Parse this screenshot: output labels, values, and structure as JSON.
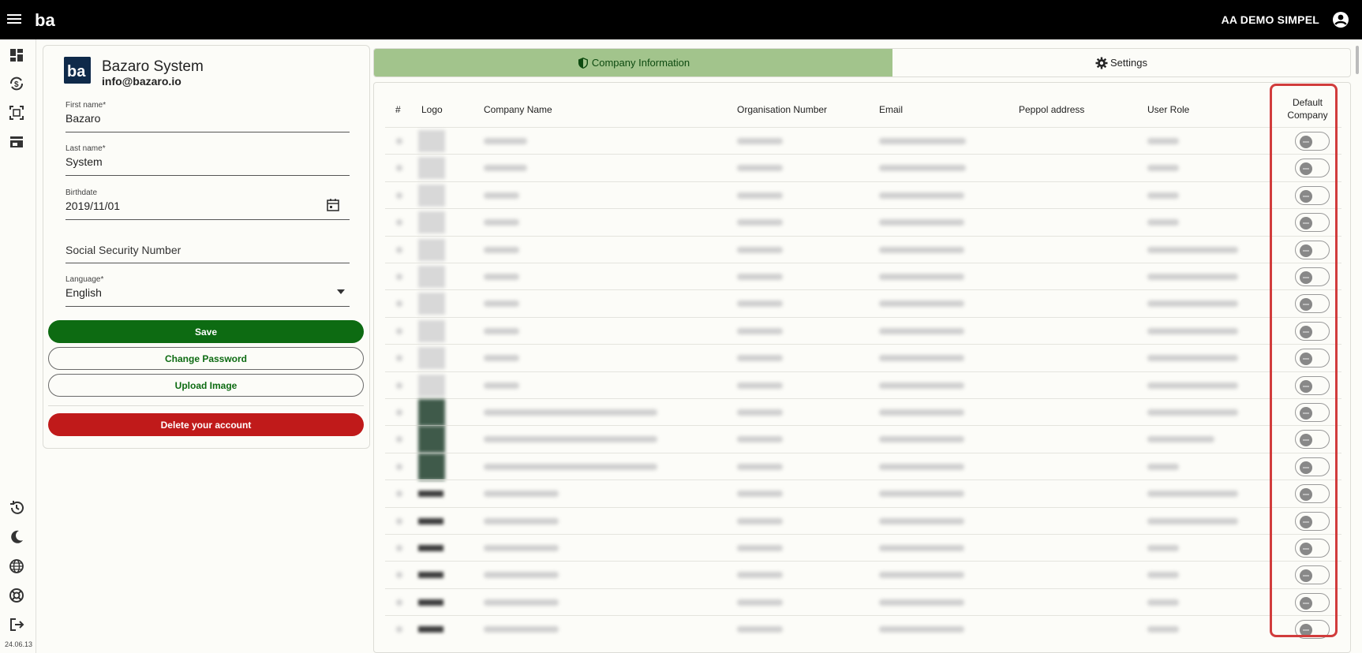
{
  "header": {
    "user_name": "AA DEMO SIMPEL"
  },
  "rail": {
    "version": "24.06.13"
  },
  "profile": {
    "display_name": "Bazaro System",
    "email": "info@bazaro.io",
    "first_name_label": "First name*",
    "first_name_value": "Bazaro",
    "last_name_label": "Last name*",
    "last_name_value": "System",
    "birthdate_label": "Birthdate",
    "birthdate_value": "2019/11/01",
    "ssn_placeholder": "Social Security Number",
    "language_label": "Language*",
    "language_value": "English",
    "save_label": "Save",
    "change_password_label": "Change Password",
    "upload_image_label": "Upload Image",
    "delete_label": "Delete your account"
  },
  "tabs": [
    {
      "label": "Company Information",
      "active": true
    },
    {
      "label": "Settings",
      "active": false
    }
  ],
  "table": {
    "columns": {
      "index": "#",
      "logo": "Logo",
      "company_name": "Company Name",
      "org_number": "Organisation Number",
      "email": "Email",
      "peppol": "Peppol address",
      "role": "User Role",
      "default_line1": "Default",
      "default_line2": "Company"
    },
    "row_count": 19
  },
  "colors": {
    "primary_green": "#0d6b12",
    "active_tab": "#a2c48c",
    "danger": "#c01a1a",
    "highlight": "#d13c3c"
  }
}
